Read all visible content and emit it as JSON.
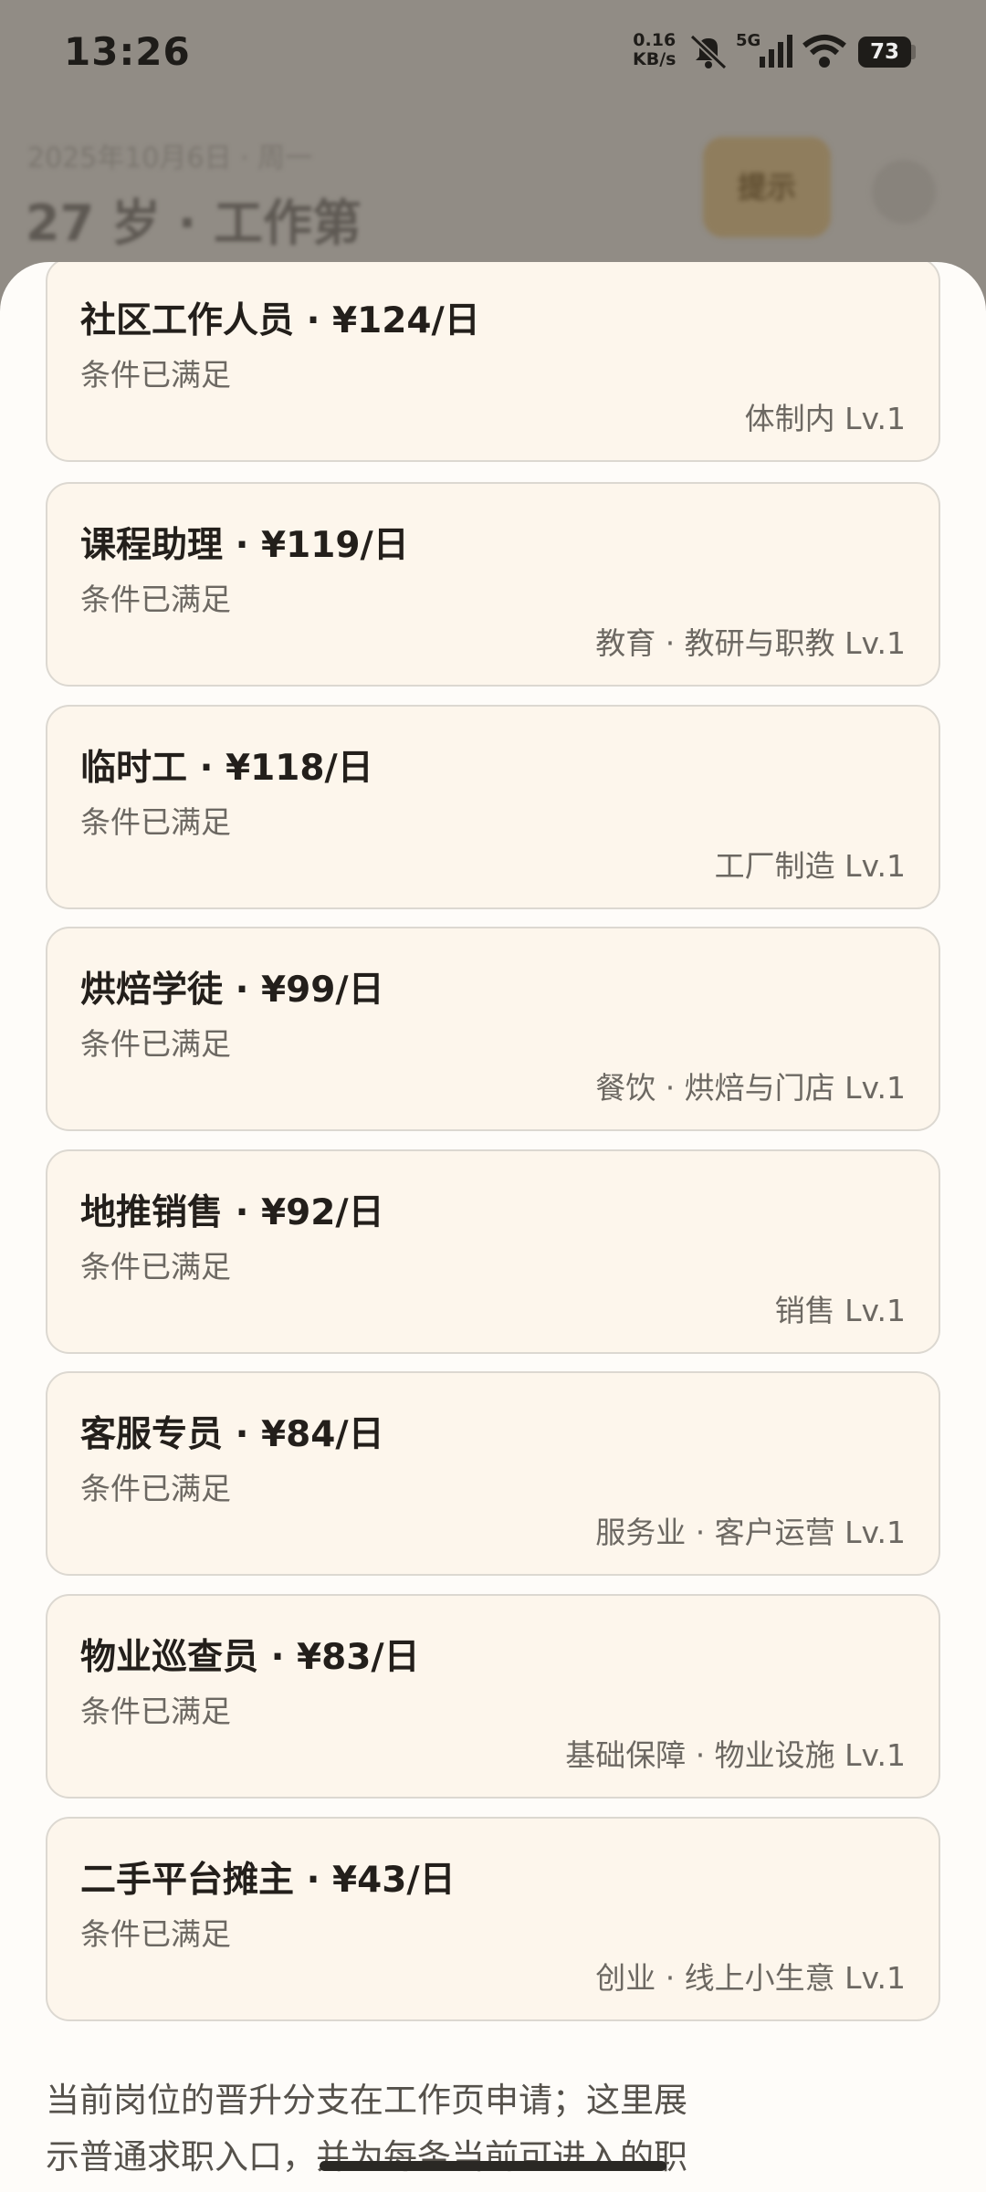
{
  "status_bar": {
    "time": "13:26",
    "net_speed_value": "0.16",
    "net_speed_unit": "KB/s",
    "network": "5G",
    "battery": "73"
  },
  "background": {
    "subtitle": "2025年10月6日 · 周一",
    "title": "27 岁 · 工作第",
    "chip": "提示"
  },
  "jobs": [
    {
      "title": "社区工作人员 · ¥124/日",
      "status": "条件已满足",
      "track": "体制内 Lv.1"
    },
    {
      "title": "课程助理 · ¥119/日",
      "status": "条件已满足",
      "track": "教育 · 教研与职教 Lv.1"
    },
    {
      "title": "临时工 · ¥118/日",
      "status": "条件已满足",
      "track": "工厂制造 Lv.1"
    },
    {
      "title": "烘焙学徒 · ¥99/日",
      "status": "条件已满足",
      "track": "餐饮 · 烘焙与门店 Lv.1"
    },
    {
      "title": "地推销售 · ¥92/日",
      "status": "条件已满足",
      "track": "销售 Lv.1"
    },
    {
      "title": "客服专员 · ¥84/日",
      "status": "条件已满足",
      "track": "服务业 · 客户运营 Lv.1"
    },
    {
      "title": "物业巡查员 · ¥83/日",
      "status": "条件已满足",
      "track": "基础保障 · 物业设施 Lv.1"
    },
    {
      "title": "二手平台摊主 · ¥43/日",
      "status": "条件已满足",
      "track": "创业 · 线上小生意 Lv.1"
    }
  ],
  "footer": {
    "line1": "当前岗位的晋升分支在工作页申请；这里展",
    "line2": "示普通求职入口，并为每条当前可进入的职"
  }
}
